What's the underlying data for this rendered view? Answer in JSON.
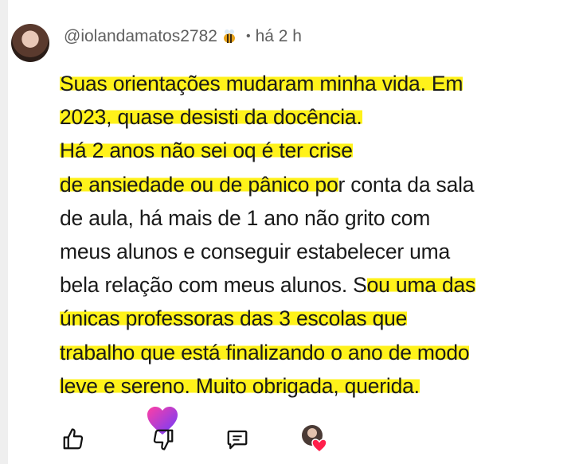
{
  "comment": {
    "username": "@iolandamatos2782",
    "separator": "•",
    "time": "há 2 h",
    "lines": [
      {
        "pre": "",
        "hl": "Suas orientações mudaram minha vida. Em",
        "post": ""
      },
      {
        "pre": "",
        "hl": "2023, quase desisti da docência.",
        "post": ""
      },
      {
        "pre": "",
        "hl": "Há 2 anos não sei oq é ter crise",
        "post": ""
      },
      {
        "pre": "",
        "hl": "de ansiedade ou de pânico po",
        "post": "r conta da sala"
      },
      {
        "pre": "de aula, há mais de 1 ano não grito com",
        "hl": "",
        "post": ""
      },
      {
        "pre": "meus alunos e conseguir estabelecer uma",
        "hl": "",
        "post": ""
      },
      {
        "pre": "bela relação com meus alunos. S",
        "hl": "ou uma das",
        "post": ""
      },
      {
        "pre": "",
        "hl": "únicas professoras das 3 escolas que",
        "post": ""
      },
      {
        "pre": "",
        "hl": "trabalho que está finalizando o ano de modo",
        "post": ""
      },
      {
        "pre": "",
        "hl": "leve e sereno. Muito obrigada, querida.",
        "post": ""
      }
    ]
  },
  "actions": {
    "like_icon": "thumbs-up-icon",
    "dislike_icon": "thumbs-down-icon",
    "reply_icon": "comment-icon",
    "creator_heart_icon": "creator-heart-icon",
    "super_heart_icon": "heart-icon"
  },
  "colors": {
    "highlight": "#fff21a",
    "heart_gradient_start": "#ff3fa4",
    "heart_gradient_end": "#6a3cff"
  }
}
